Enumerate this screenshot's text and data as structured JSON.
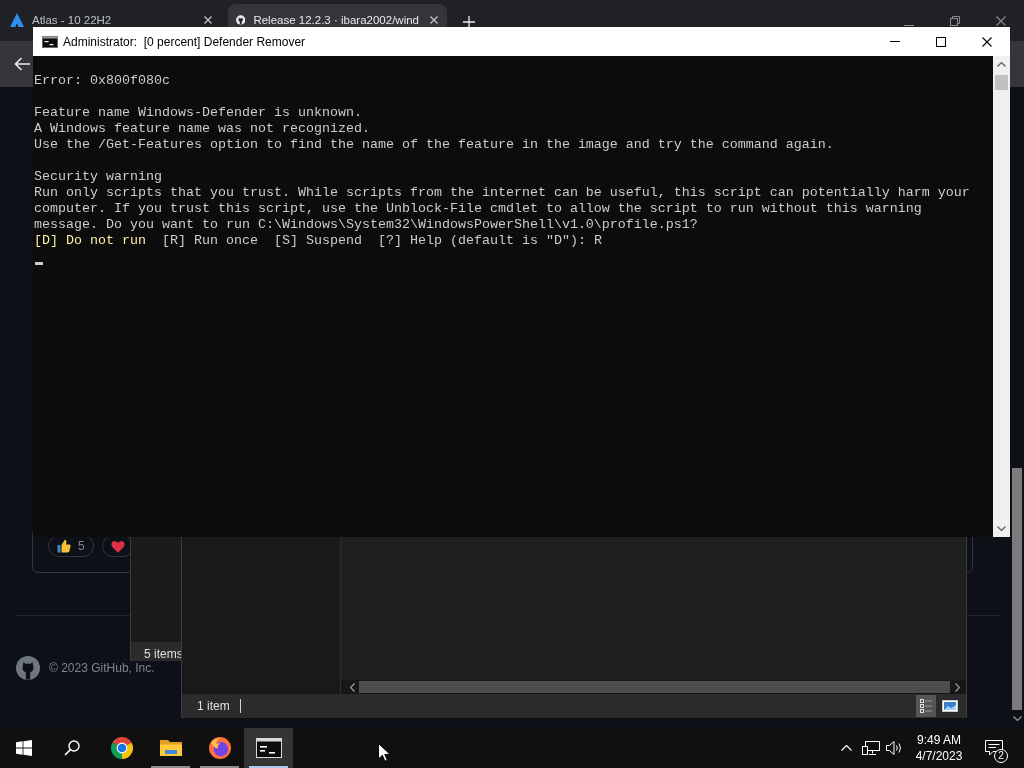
{
  "browser": {
    "tabs": [
      {
        "kind": "atlas",
        "title": "Atlas - 10 22H2",
        "selected": false
      },
      {
        "kind": "github",
        "title": "Release 12.2.3 · ibara2002/wind",
        "selected": true
      }
    ],
    "page": {
      "reactions": [
        {
          "kind": "thumbs_up",
          "count": "5"
        },
        {
          "kind": "heart"
        }
      ],
      "footer": "© 2023 GitHub, Inc."
    }
  },
  "explorer_behind": {
    "status": "5 items"
  },
  "explorer": {
    "status": "1 item",
    "views": [
      {
        "kind": "details",
        "selected": true
      },
      {
        "kind": "large_icons",
        "selected": false
      }
    ]
  },
  "console": {
    "title": "Administrator:  [0 percent] Defender Remover",
    "lines": [
      {
        "kind": "blank"
      },
      {
        "kind": "text",
        "text": "Error: 0x800f080c"
      },
      {
        "kind": "blank"
      },
      {
        "kind": "text",
        "text": "Feature name Windows-Defender is unknown."
      },
      {
        "kind": "text",
        "text": "A Windows feature name was not recognized."
      },
      {
        "kind": "text",
        "text": "Use the /Get-Features option to find the name of the feature in the image and try the command again."
      },
      {
        "kind": "blank"
      },
      {
        "kind": "text",
        "text": "Security warning"
      },
      {
        "kind": "text",
        "text": "Run only scripts that you trust. While scripts from the internet can be useful, this script can potentially harm your"
      },
      {
        "kind": "text",
        "text": "computer. If you trust this script, use the Unblock-File cmdlet to allow the script to run without this warning"
      },
      {
        "kind": "text",
        "text": "message. Do you want to run C:\\Windows\\System32\\WindowsPowerShell\\v1.0\\profile.ps1?"
      },
      {
        "kind": "choices",
        "choices": [
          {
            "text": "[D] Do not run",
            "highlighted": true
          },
          {
            "text": "[R] Run once",
            "highlighted": false
          },
          {
            "text": "[S] Suspend",
            "highlighted": false
          },
          {
            "text": "[?] Help (default is \"D\"): R",
            "highlighted": false
          }
        ]
      },
      {
        "kind": "cursor"
      }
    ]
  },
  "taskbar": {
    "apps": [
      {
        "kind": "chrome",
        "open": false,
        "selected": false
      },
      {
        "kind": "explorer",
        "open": true,
        "selected": false
      },
      {
        "kind": "firefox",
        "open": true,
        "selected": false
      },
      {
        "kind": "console",
        "open": true,
        "selected": true
      }
    ],
    "clock": {
      "time": "9:49 AM",
      "date": "4/7/2023"
    },
    "notification_count": "2"
  }
}
